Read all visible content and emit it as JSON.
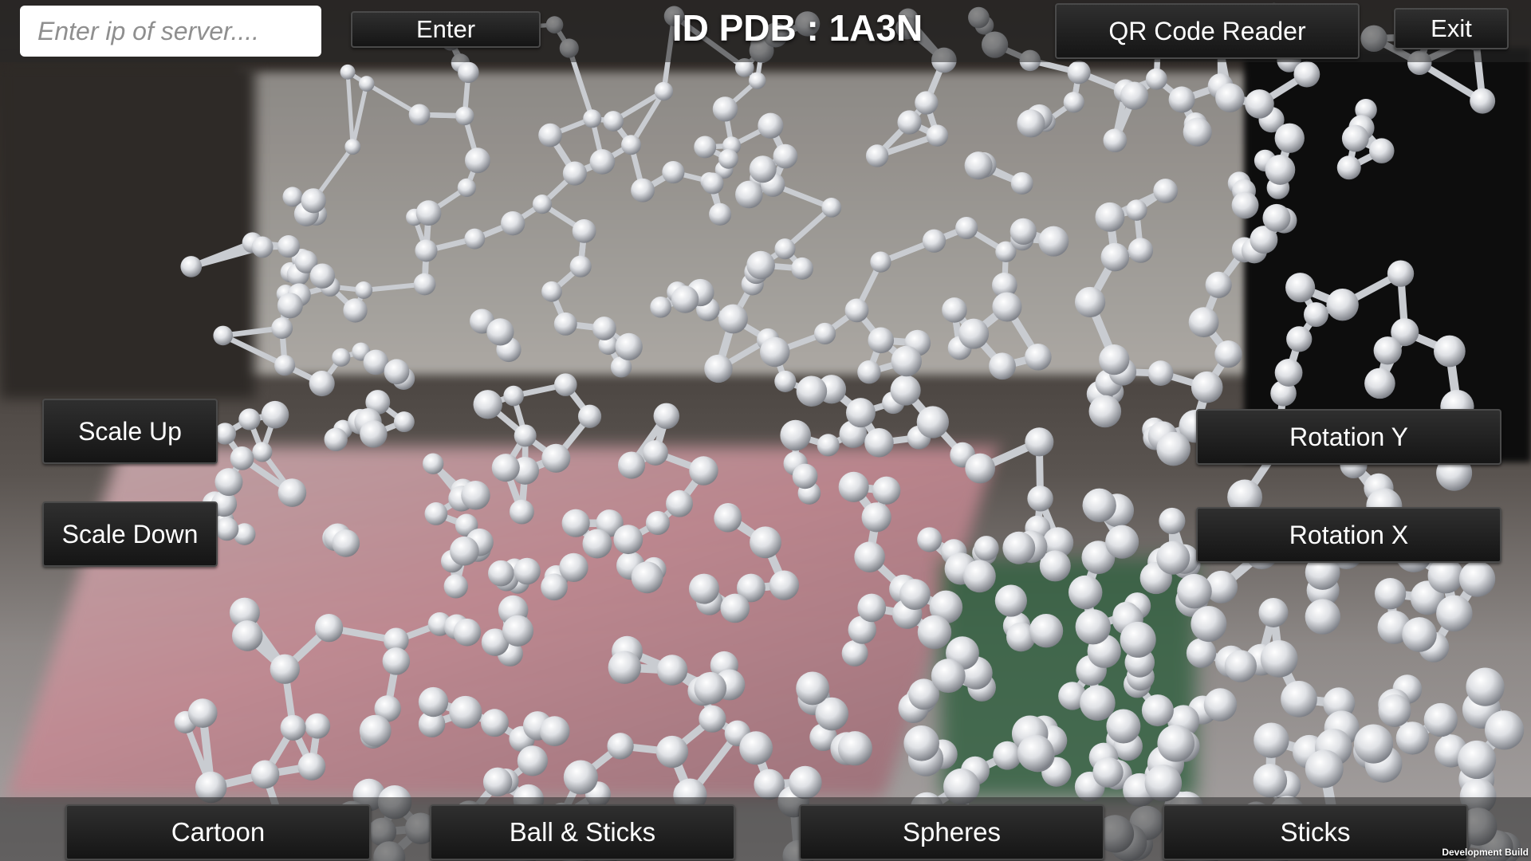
{
  "header": {
    "ip_placeholder": "Enter ip of server....",
    "enter_label": "Enter",
    "title": "ID PDB : 1A3N",
    "qr_label": "QR Code Reader",
    "exit_label": "Exit"
  },
  "left_controls": {
    "scale_up_label": "Scale Up",
    "scale_down_label": "Scale Down"
  },
  "right_controls": {
    "rotation_y_label": "Rotation Y",
    "rotation_x_label": "Rotation X"
  },
  "render_modes": [
    {
      "label": "Cartoon"
    },
    {
      "label": "Ball & Sticks"
    },
    {
      "label": "Spheres"
    },
    {
      "label": "Sticks"
    }
  ],
  "footer": {
    "build_label": "Development Build"
  },
  "colors": {
    "atom": "#e4e6ea",
    "button_bg": "#1b1b1b",
    "button_text": "#ffffff"
  }
}
